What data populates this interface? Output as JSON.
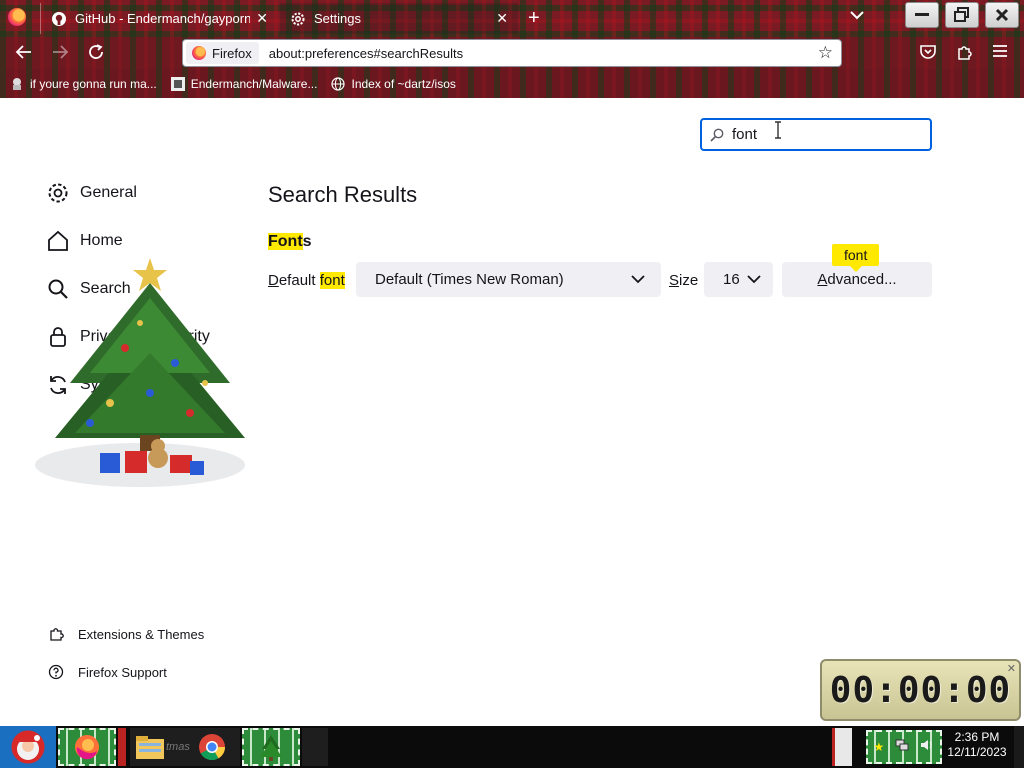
{
  "titlebar": {
    "tabs": [
      {
        "title": "GitHub - Endermanch/gaypornar...",
        "active": false
      },
      {
        "title": "Settings",
        "active": true
      }
    ]
  },
  "navbar": {
    "identity_label": "Firefox",
    "url": "about:preferences#searchResults"
  },
  "bookmarks": [
    {
      "label": "if youre gonna run ma...",
      "icon": "bookmark-favicon-icon"
    },
    {
      "label": "Endermanch/Malware...",
      "icon": "github-icon"
    },
    {
      "label": "Index of ~dartz/isos",
      "icon": "globe-icon"
    }
  ],
  "preferences": {
    "search_value": "font",
    "sidebar": [
      {
        "label": "General",
        "icon": "gear-icon"
      },
      {
        "label": "Home",
        "icon": "home-icon"
      },
      {
        "label": "Search",
        "icon": "search-icon"
      },
      {
        "label": "Privacy & Security",
        "icon": "lock-icon"
      },
      {
        "label": "Sync",
        "icon": "sync-icon"
      }
    ],
    "footer": [
      {
        "label": "Extensions & Themes",
        "icon": "puzzle-icon"
      },
      {
        "label": "Firefox Support",
        "icon": "help-icon"
      }
    ],
    "results_title": "Search Results",
    "fonts_heading_hl": "Font",
    "fonts_heading_rest": "s",
    "default_font_label_u": "D",
    "default_font_label_mid": "efault ",
    "default_font_label_hl": "font",
    "default_font_value": "Default (Times New Roman)",
    "size_label_u": "S",
    "size_label_rest": "ize",
    "size_value": "16",
    "advanced_u": "A",
    "advanced_rest": "dvanced...",
    "advanced_badge": "font"
  },
  "countdown": {
    "digits": "00:00:00"
  },
  "taskbar": {
    "tray_time": "2:36 PM",
    "tray_date": "12/11/2023"
  },
  "colors": {
    "accent": "#0061e0",
    "highlight": "#ffe900",
    "button_bg": "#f0f0f4",
    "titlebar_plaid": "#7a1a22"
  }
}
